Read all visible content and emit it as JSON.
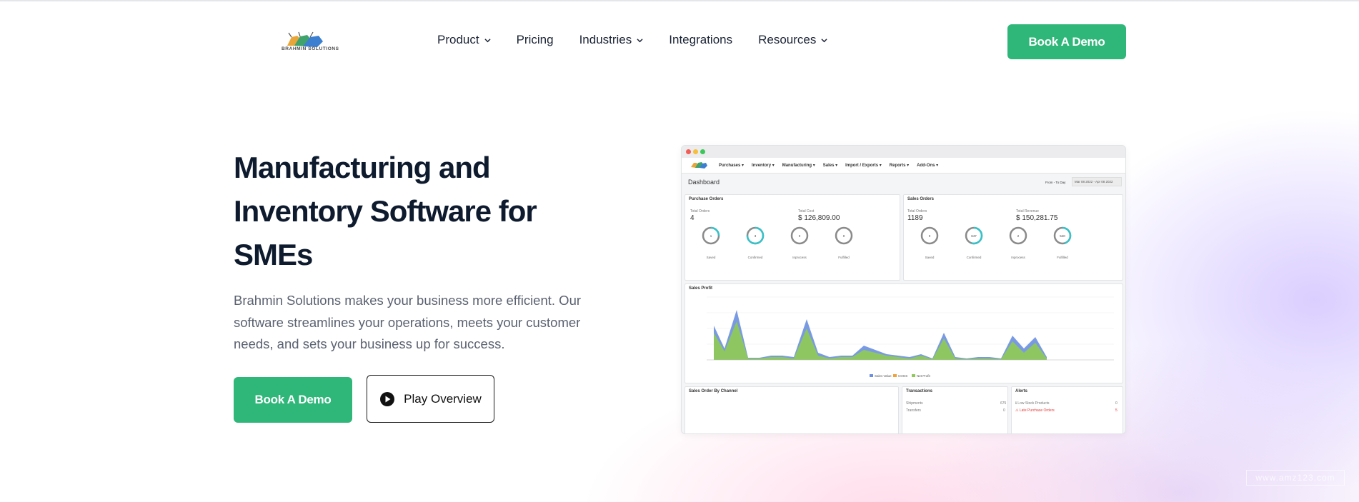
{
  "brand": {
    "name": "BRAHMIN SOLUTIONS"
  },
  "nav": {
    "items": [
      {
        "label": "Product",
        "has_dropdown": true
      },
      {
        "label": "Pricing",
        "has_dropdown": false
      },
      {
        "label": "Industries",
        "has_dropdown": true
      },
      {
        "label": "Integrations",
        "has_dropdown": false
      },
      {
        "label": "Resources",
        "has_dropdown": true
      }
    ],
    "cta": "Book A Demo"
  },
  "hero": {
    "title_line1": "Manufacturing and",
    "title_line2": "Inventory Software for",
    "title_line3": "SMEs",
    "description": "Brahmin Solutions makes your business more efficient. Our software streamlines your operations, meets your customer needs, and sets your business up for success.",
    "primary_cta": "Book A Demo",
    "secondary_cta": "Play Overview"
  },
  "dashboard": {
    "menu": [
      "Purchases ▾",
      "Inventory ▾",
      "Manufacturing ▾",
      "Sales ▾",
      "Import / Exports ▾",
      "Reports ▾",
      "Add-Ons ▾"
    ],
    "title": "Dashboard",
    "range_label": "From - To Day",
    "range_value": "Mar 08 2022 - Apr 08 2022",
    "purchase_orders": {
      "title": "Purchase Orders",
      "total_orders_label": "Total Orders",
      "total_orders": "4",
      "total_cost_label": "Total Cost",
      "total_cost": "$ 126,809.00",
      "rings": [
        {
          "value": "1",
          "label": "Saved",
          "fraction": 0.25
        },
        {
          "value": "3",
          "label": "Confirmed",
          "fraction": 0.75
        },
        {
          "value": "0",
          "label": "Inprocess",
          "fraction": 0
        },
        {
          "value": "0",
          "label": "Fulfilled",
          "fraction": 0
        }
      ]
    },
    "sales_orders": {
      "title": "Sales Orders",
      "total_orders_label": "Total Orders",
      "total_orders": "1189",
      "total_revenue_label": "Total Revenue",
      "total_revenue": "$ 150,281.75",
      "rings": [
        {
          "value": "0",
          "label": "Saved",
          "fraction": 0
        },
        {
          "value": "647",
          "label": "Confirmed",
          "fraction": 0.55
        },
        {
          "value": "2",
          "label": "Inprocess",
          "fraction": 0
        },
        {
          "value": "540",
          "label": "Fulfilled",
          "fraction": 0.45
        }
      ]
    },
    "sales_profit": {
      "title": "Sales Profit",
      "legend": [
        "Sales Value",
        "COGS",
        "Net Profit"
      ],
      "colors": {
        "sales": "#6a8fe0",
        "cogs": "#f0a23c",
        "profit": "#8fc85a"
      }
    },
    "channel": {
      "title": "Sales Order By Channel"
    },
    "transactions": {
      "title": "Transactions",
      "rows": [
        {
          "label": "Shipments",
          "value": "675"
        },
        {
          "label": "Transfers",
          "value": "0"
        }
      ]
    },
    "alerts": {
      "title": "Alerts",
      "rows": [
        {
          "label": "Low Stock Products",
          "value": "0"
        },
        {
          "label": "Late Purchase Orders",
          "value": "5"
        }
      ]
    }
  },
  "watermark": "www.amz123.com",
  "colors": {
    "accent": "#2fb679",
    "heading": "#0e1b2e",
    "body": "#5a6170"
  }
}
